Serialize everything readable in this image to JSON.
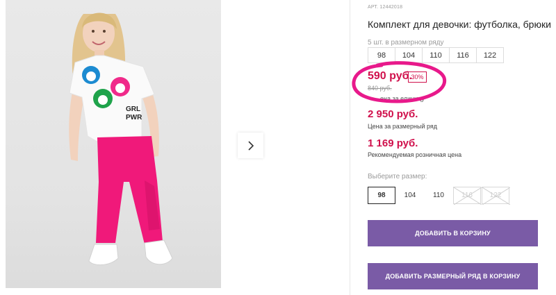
{
  "product": {
    "sku": "АРТ. 12442018",
    "title": "Комплект для девочки: футболка, брюки",
    "pack_label": "5 шт. в размерном ряду",
    "pack_sizes": [
      "98",
      "104",
      "110",
      "116",
      "122"
    ]
  },
  "price": {
    "unit": "590 руб.",
    "discount": "30%",
    "old": "840 руб.",
    "unit_label": "ена за единицу",
    "row": "2 950 руб.",
    "row_label": "Цена за размерный ряд",
    "rrp": "1 169 руб.",
    "rrp_label": "Рекомендуемая розничная цена"
  },
  "size_picker": {
    "label": "Выберите размер:",
    "options": [
      {
        "label": "98",
        "state": "selected"
      },
      {
        "label": "104",
        "state": "available"
      },
      {
        "label": "110",
        "state": "available"
      },
      {
        "label": "116",
        "state": "disabled"
      },
      {
        "label": "122",
        "state": "disabled"
      }
    ]
  },
  "buttons": {
    "add_to_cart": "ДОБАВИТЬ В КОРЗИНУ",
    "add_row_to_cart": "ДОБАВИТЬ РАЗМЕРНЫЙ РЯД В КОРЗИНУ"
  },
  "photo": {
    "shirt_text": "GRL PWR"
  },
  "gallery": {
    "next_icon": "chevron-right-icon"
  },
  "colors": {
    "price": "#d0104c",
    "button": "#7a5ba6",
    "marker": "#e8198b",
    "pants": "#f0197a"
  }
}
